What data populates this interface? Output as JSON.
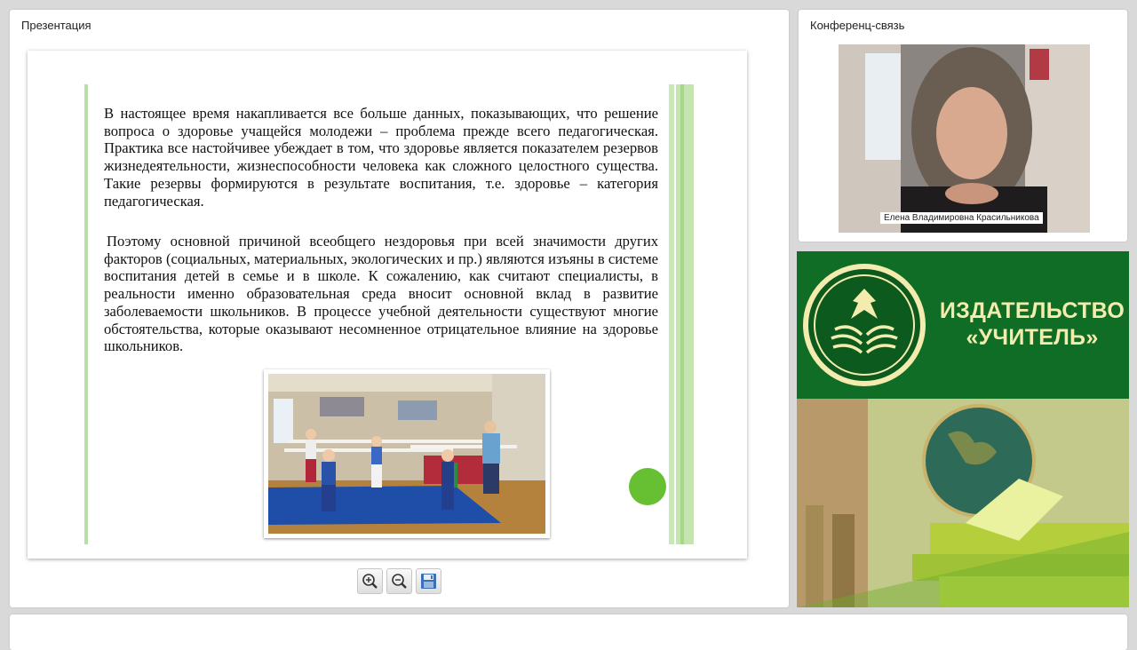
{
  "presentation": {
    "title": "Презентация",
    "paragraphs": [
      "В настоящее время накапливается все больше данных, показывающих, что решение вопроса о здоровье учащейся молодежи – проблема прежде всего педагогическая. Практика все настойчивее убеждает в том, что здоровье является показателем резервов жизнедеятельности, жизнеспособности человека как сложного целостного существа. Такие резервы формируются в результате воспитания, т.е. здоровье – категория педагогическая.",
      "Поэтому основной причиной всеобщего нездоровья при всей значимости других факторов (социальных, материальных, экологических и пр.) являются изъяны в системе воспитания детей в семье и в школе. К сожалению, как считают специалисты, в реальности именно образовательная среда вносит основной вклад в развитие заболеваемости школьников. В процессе учебной деятельности существуют многие обстоятельства, которые оказывают несомненное отрицательное влияние на здоровье школьников."
    ],
    "toolbar": {
      "zoom_in_icon": "zoom-in-icon",
      "zoom_out_icon": "zoom-out-icon",
      "save_icon": "floppy-disk-icon"
    }
  },
  "conference": {
    "title": "Конференц-связь",
    "participant_name": "Елена Владимировна Красильникова"
  },
  "ad": {
    "publisher_line1": "ИЗДАТЕЛЬСТВО",
    "publisher_line2": "«УЧИТЕЛЬ»"
  },
  "colors": {
    "accent_green": "#66c032",
    "brand_dark_green": "#106d25",
    "brand_cream": "#f4ecae"
  }
}
